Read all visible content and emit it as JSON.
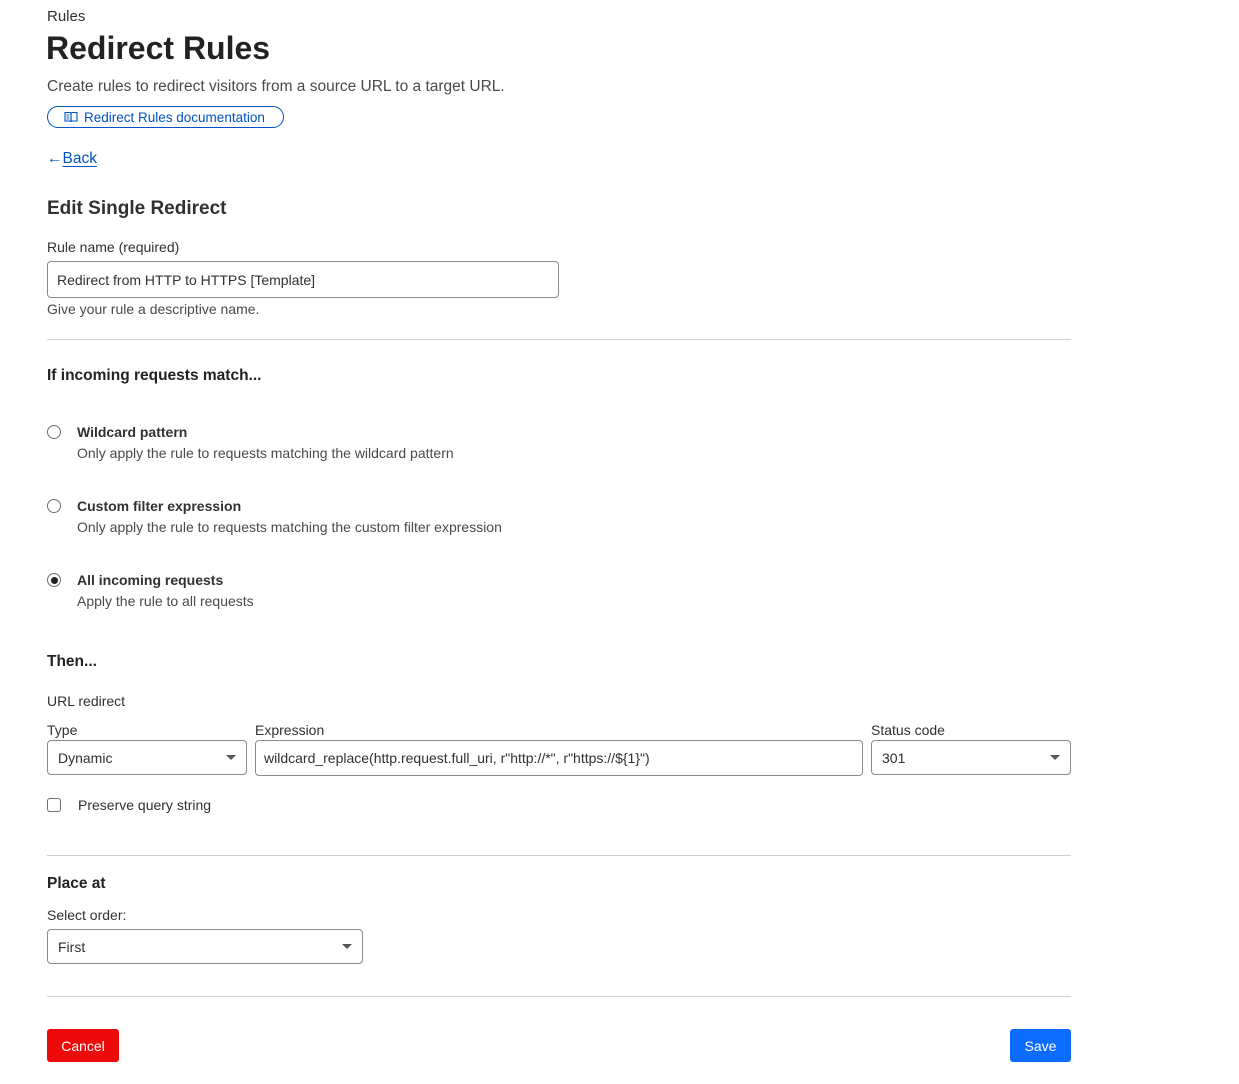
{
  "breadcrumb": "Rules",
  "page_title": "Redirect Rules",
  "subtitle": "Create rules to redirect visitors from a source URL to a target URL.",
  "doc_link": {
    "label": "Redirect Rules documentation",
    "icon": "book-icon"
  },
  "back": {
    "arrow": "←",
    "label": "Back"
  },
  "section_title": "Edit Single Redirect",
  "rule_name": {
    "label": "Rule name (required)",
    "value": "Redirect from HTTP to HTTPS [Template]",
    "hint": "Give your rule a descriptive name."
  },
  "match": {
    "heading": "If incoming requests match...",
    "options": [
      {
        "title": "Wildcard pattern",
        "desc": "Only apply the rule to requests matching the wildcard pattern",
        "checked": false
      },
      {
        "title": "Custom filter expression",
        "desc": "Only apply the rule to requests matching the custom filter expression",
        "checked": false
      },
      {
        "title": "All incoming requests",
        "desc": "Apply the rule to all requests",
        "checked": true
      }
    ]
  },
  "then": {
    "heading": "Then...",
    "sub": "URL redirect",
    "type": {
      "label": "Type",
      "value": "Dynamic"
    },
    "expression": {
      "label": "Expression",
      "value": "wildcard_replace(http.request.full_uri, r\"http://*\", r\"https://${1}\")"
    },
    "status": {
      "label": "Status code",
      "value": "301"
    },
    "preserve_query": {
      "label": "Preserve query string",
      "checked": false
    }
  },
  "place": {
    "heading": "Place at",
    "order_label": "Select order:",
    "order_value": "First"
  },
  "buttons": {
    "cancel": "Cancel",
    "save": "Save"
  },
  "colors": {
    "link": "#0051c3",
    "cancel": "#ec0a0a",
    "save": "#0b6cff"
  }
}
